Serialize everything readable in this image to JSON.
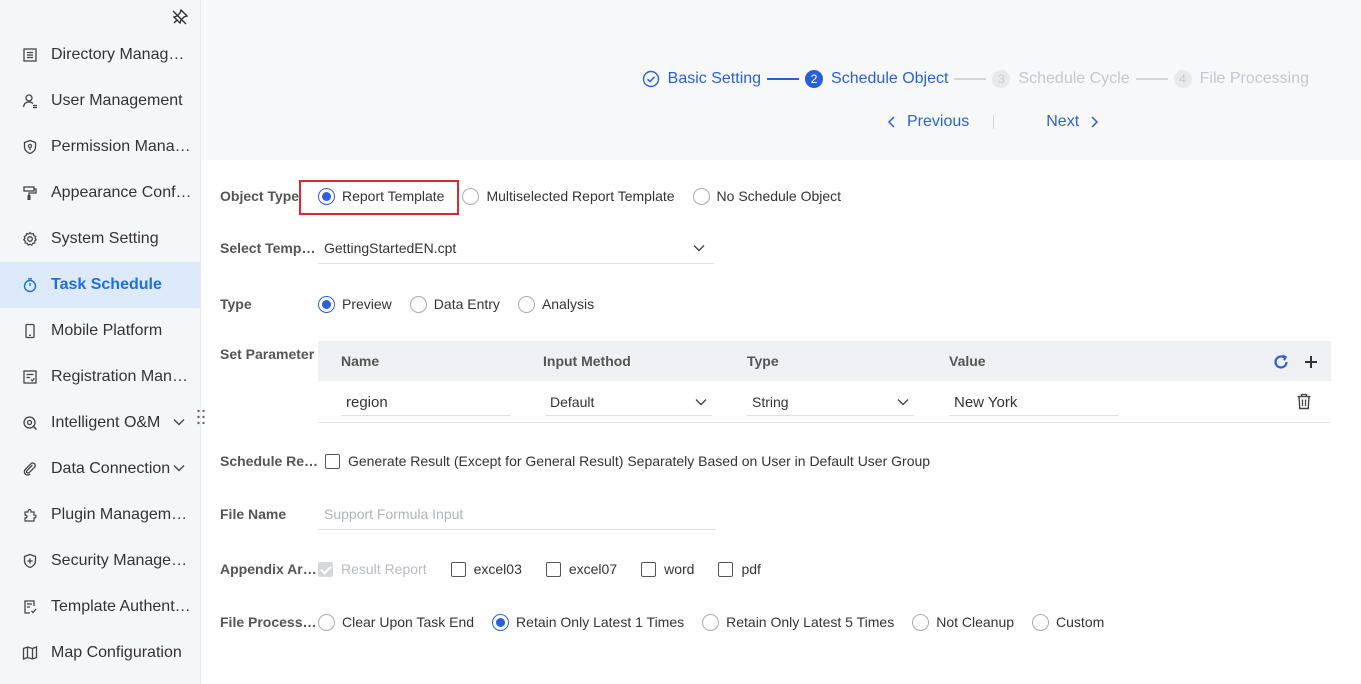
{
  "sidebar": {
    "items": [
      {
        "label": "Directory Management",
        "icon": "list-icon"
      },
      {
        "label": "User Management",
        "icon": "user-icon"
      },
      {
        "label": "Permission Management",
        "icon": "shield-icon"
      },
      {
        "label": "Appearance Configuration",
        "icon": "paint-roller-icon"
      },
      {
        "label": "System Setting",
        "icon": "gear-icon"
      },
      {
        "label": "Task Schedule",
        "icon": "stopwatch-icon",
        "active": true
      },
      {
        "label": "Mobile Platform",
        "icon": "mobile-icon"
      },
      {
        "label": "Registration Management",
        "icon": "registration-icon"
      },
      {
        "label": "Intelligent O&M",
        "icon": "monitor-icon",
        "expandable": true
      },
      {
        "label": "Data Connection",
        "icon": "paperclip-icon",
        "expandable": true
      },
      {
        "label": "Plugin Management",
        "icon": "puzzle-icon"
      },
      {
        "label": "Security Management",
        "icon": "security-shield-icon"
      },
      {
        "label": "Template Authentication",
        "icon": "template-auth-icon"
      },
      {
        "label": "Map Configuration",
        "icon": "map-icon"
      }
    ]
  },
  "steps": [
    {
      "num": "",
      "label": "Basic Setting",
      "state": "done"
    },
    {
      "num": "2",
      "label": "Schedule Object",
      "state": "current"
    },
    {
      "num": "3",
      "label": "Schedule Cycle",
      "state": "todo"
    },
    {
      "num": "4",
      "label": "File Processing",
      "state": "todo"
    }
  ],
  "nav": {
    "previous": "Previous",
    "next": "Next"
  },
  "form": {
    "object_type": {
      "label": "Object Type",
      "options": [
        "Report Template",
        "Multiselected Report Template",
        "No Schedule Object"
      ],
      "selected": "Report Template"
    },
    "select_template": {
      "label": "Select Template",
      "value": "GettingStartedEN.cpt"
    },
    "type": {
      "label": "Type",
      "options": [
        "Preview",
        "Data Entry",
        "Analysis"
      ],
      "selected": "Preview"
    },
    "set_parameter": {
      "label": "Set Parameter",
      "columns": [
        "Name",
        "Input Method",
        "Type",
        "Value"
      ],
      "rows": [
        {
          "name": "region",
          "input_method": "Default",
          "type": "String",
          "value": "New York"
        }
      ]
    },
    "schedule_result": {
      "label": "Schedule Result",
      "checkbox": "Generate Result (Except for General Result) Separately Based on User in Default User Group"
    },
    "file_name": {
      "label": "File Name",
      "placeholder": "Support Formula Input"
    },
    "appendix": {
      "label": "Appendix Area",
      "options": [
        "Result Report",
        "excel03",
        "excel07",
        "word",
        "pdf"
      ]
    },
    "file_processing": {
      "label": "File Processing",
      "options": [
        "Clear Upon Task End",
        "Retain Only Latest 1 Times",
        "Retain Only Latest 5 Times",
        "Not Cleanup",
        "Custom"
      ],
      "selected": "Retain Only Latest 1 Times"
    }
  },
  "colors": {
    "accent": "#2b5fd9",
    "highlight": "#e0262c",
    "active_bg": "#dceafb"
  }
}
